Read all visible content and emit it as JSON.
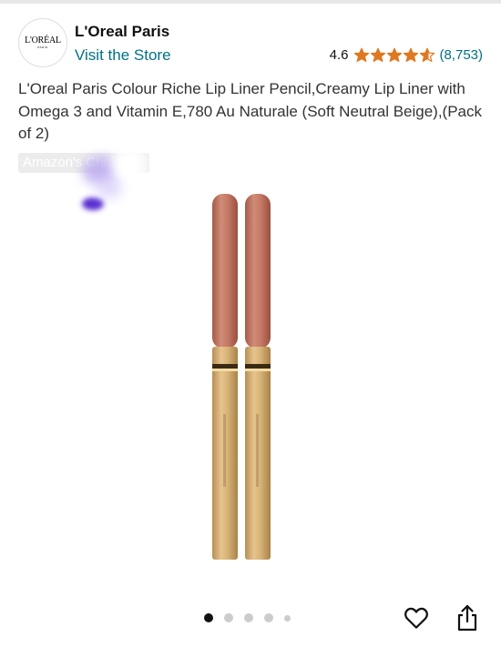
{
  "store": {
    "logo_text": "L'ORÉAL",
    "logo_subtext": "PARIS",
    "name": "L'Oreal Paris",
    "visit_label": "Visit the Store"
  },
  "rating": {
    "value": "4.6",
    "stars": 4.6,
    "count": "(8,753)",
    "star_color": "#de7921"
  },
  "product": {
    "title": "L'Oreal Paris Colour Riche Lip Liner Pencil,Creamy Lip Liner with Omega 3 and Vitamin E,780 Au Naturale (Soft Neutral Beige),(Pack of 2)",
    "badge": "Amazon's Choice"
  },
  "gallery": {
    "total_images": 5,
    "active_index": 0
  },
  "colors": {
    "link": "#007185",
    "pencil_tip": "#c27a66",
    "pencil_body": "#d9b277"
  }
}
